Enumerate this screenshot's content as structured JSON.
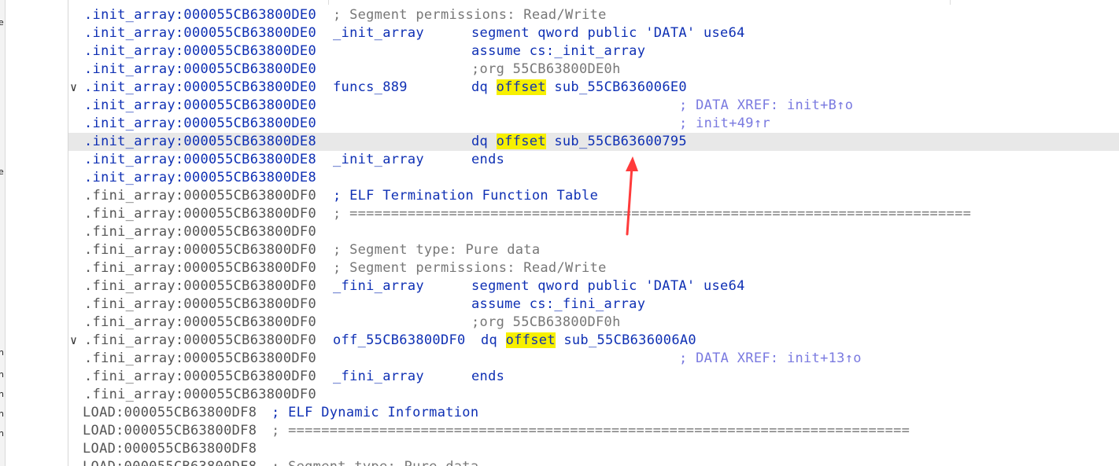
{
  "left_strip": [
    "e",
    "e",
    "n",
    "n",
    "n",
    "n",
    "n"
  ],
  "rows": [
    {
      "seg": "init",
      "addr": ".init_array:000055CB63800DE0",
      "sep": " ",
      "a": "; Segment permissions: Read/Write",
      "a_cls": "cmt-gray"
    },
    {
      "seg": "init",
      "addr": ".init_array:000055CB63800DE0",
      "sep": " ",
      "a": "_init_array",
      "a_cls": "lbl",
      "b": "segment qword public 'DATA' use64",
      "b_cls": "kw"
    },
    {
      "seg": "init",
      "addr": ".init_array:000055CB63800DE0",
      "b": "assume cs:_init_array",
      "b_cls": "kw"
    },
    {
      "seg": "init",
      "addr": ".init_array:000055CB63800DE0",
      "b": ";org 55CB63800DE0h",
      "b_cls": "cmt-gray"
    },
    {
      "seg": "init",
      "addr": ".init_array:000055CB63800DE0",
      "a": "funcs_889",
      "a_cls": "lbl",
      "b_pre": "dq ",
      "b_hl": "offset",
      "b_post": " sub_55CB636006E0",
      "b_cls": "kw",
      "marker": true
    },
    {
      "seg": "init",
      "addr": ".init_array:000055CB63800DE0",
      "xref": "; DATA XREF: init+B↑o"
    },
    {
      "seg": "init",
      "addr": ".init_array:000055CB63800DE0",
      "xref": "; init+49↑r"
    },
    {
      "seg": "init",
      "addr": ".init_array:000055CB63800DE8",
      "b_pre": "dq ",
      "b_hl": "offset",
      "b_post": " sub_55CB63600795",
      "b_cls": "kw",
      "highlight": true
    },
    {
      "seg": "init",
      "addr": ".init_array:000055CB63800DE8",
      "a": "_init_array",
      "a_cls": "lbl",
      "b": "ends",
      "b_cls": "kw"
    },
    {
      "seg": "init",
      "addr": ".init_array:000055CB63800DE8"
    },
    {
      "seg": "fini",
      "addr": ".fini_array:000055CB63800DF0",
      "a": "; ELF Termination Function Table",
      "a_cls": "cmt-blue"
    },
    {
      "seg": "fini",
      "addr": ".fini_array:000055CB63800DF0",
      "a": "; ===========================================================================",
      "a_cls": "cmt-gray"
    },
    {
      "seg": "fini",
      "addr": ".fini_array:000055CB63800DF0"
    },
    {
      "seg": "fini",
      "addr": ".fini_array:000055CB63800DF0",
      "a": "; Segment type: Pure data",
      "a_cls": "cmt-gray"
    },
    {
      "seg": "fini",
      "addr": ".fini_array:000055CB63800DF0",
      "a": "; Segment permissions: Read/Write",
      "a_cls": "cmt-gray"
    },
    {
      "seg": "fini",
      "addr": ".fini_array:000055CB63800DF0",
      "a": "_fini_array",
      "a_cls": "lbl",
      "b": "segment qword public 'DATA' use64",
      "b_cls": "kw"
    },
    {
      "seg": "fini",
      "addr": ".fini_array:000055CB63800DF0",
      "b": "assume cs:_fini_array",
      "b_cls": "kw"
    },
    {
      "seg": "fini",
      "addr": ".fini_array:000055CB63800DF0",
      "b": ";org 55CB63800DF0h",
      "b_cls": "cmt-gray"
    },
    {
      "seg": "fini",
      "addr": ".fini_array:000055CB63800DF0",
      "a": "off_55CB63800DF0",
      "a_cls": "lbl",
      "b_inline": true,
      "b_pre": "dq ",
      "b_hl": "offset",
      "b_post": " sub_55CB636006A0",
      "b_cls": "kw",
      "marker": true
    },
    {
      "seg": "fini",
      "addr": ".fini_array:000055CB63800DF0",
      "xref": "; DATA XREF: init+13↑o"
    },
    {
      "seg": "fini",
      "addr": ".fini_array:000055CB63800DF0",
      "a": "_fini_array",
      "a_cls": "lbl",
      "b": "ends",
      "b_cls": "kw"
    },
    {
      "seg": "fini",
      "addr": ".fini_array:000055CB63800DF0"
    },
    {
      "seg": "load",
      "addr": "LOAD:000055CB63800DF8",
      "a": "; ELF Dynamic Information",
      "a_cls": "cmt-blue"
    },
    {
      "seg": "load",
      "addr": "LOAD:000055CB63800DF8",
      "a": "; ===========================================================================",
      "a_cls": "cmt-gray"
    },
    {
      "seg": "load",
      "addr": "LOAD:000055CB63800DF8"
    },
    {
      "seg": "load",
      "addr": "LOAD:000055CB63800DF8",
      "a": "; Segment type: Pure data",
      "a_cls": "cmt-gray"
    }
  ],
  "colors": {
    "blue": "#0f30b4",
    "gray": "#555555",
    "xref": "#7a7ae0",
    "highlight_word": "#f7f000",
    "highlight_row": "#e8e8e8",
    "annotation_arrow": "#ff3b3b",
    "marker_dot": "#3fb6e6"
  }
}
